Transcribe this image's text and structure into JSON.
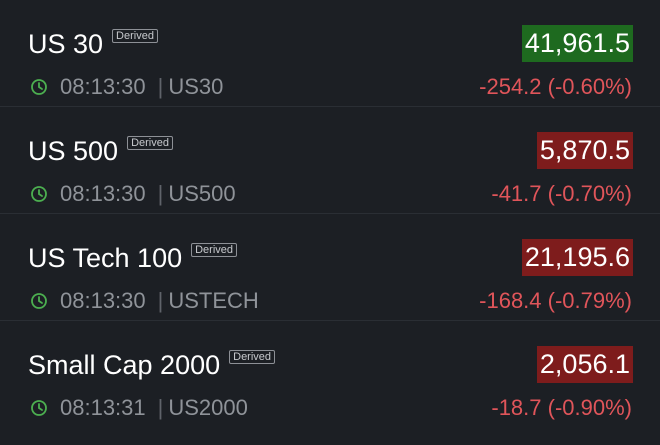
{
  "badge_label": "Derived",
  "instruments": [
    {
      "name": "US 30",
      "price": "41,961.5",
      "direction": "up",
      "time": "08:13:30",
      "symbol": "US30",
      "change": "-254.2 (-0.60%)"
    },
    {
      "name": "US 500",
      "price": "5,870.5",
      "direction": "down",
      "time": "08:13:30",
      "symbol": "US500",
      "change": "-41.7 (-0.70%)"
    },
    {
      "name": "US Tech 100",
      "price": "21,195.6",
      "direction": "down",
      "time": "08:13:30",
      "symbol": "USTECH",
      "change": "-168.4 (-0.79%)"
    },
    {
      "name": "Small Cap 2000",
      "price": "2,056.1",
      "direction": "down",
      "time": "08:13:31",
      "symbol": "US2000",
      "change": "-18.7 (-0.90%)"
    }
  ],
  "colors": {
    "background": "#1c1f24",
    "price_up_bg": "#1e6a1f",
    "price_down_bg": "#7e1c1c",
    "change_negative": "#e0555a",
    "clock_icon": "#4caf50",
    "meta_text": "#8f9399"
  },
  "icons": {
    "time": "clock-icon"
  }
}
